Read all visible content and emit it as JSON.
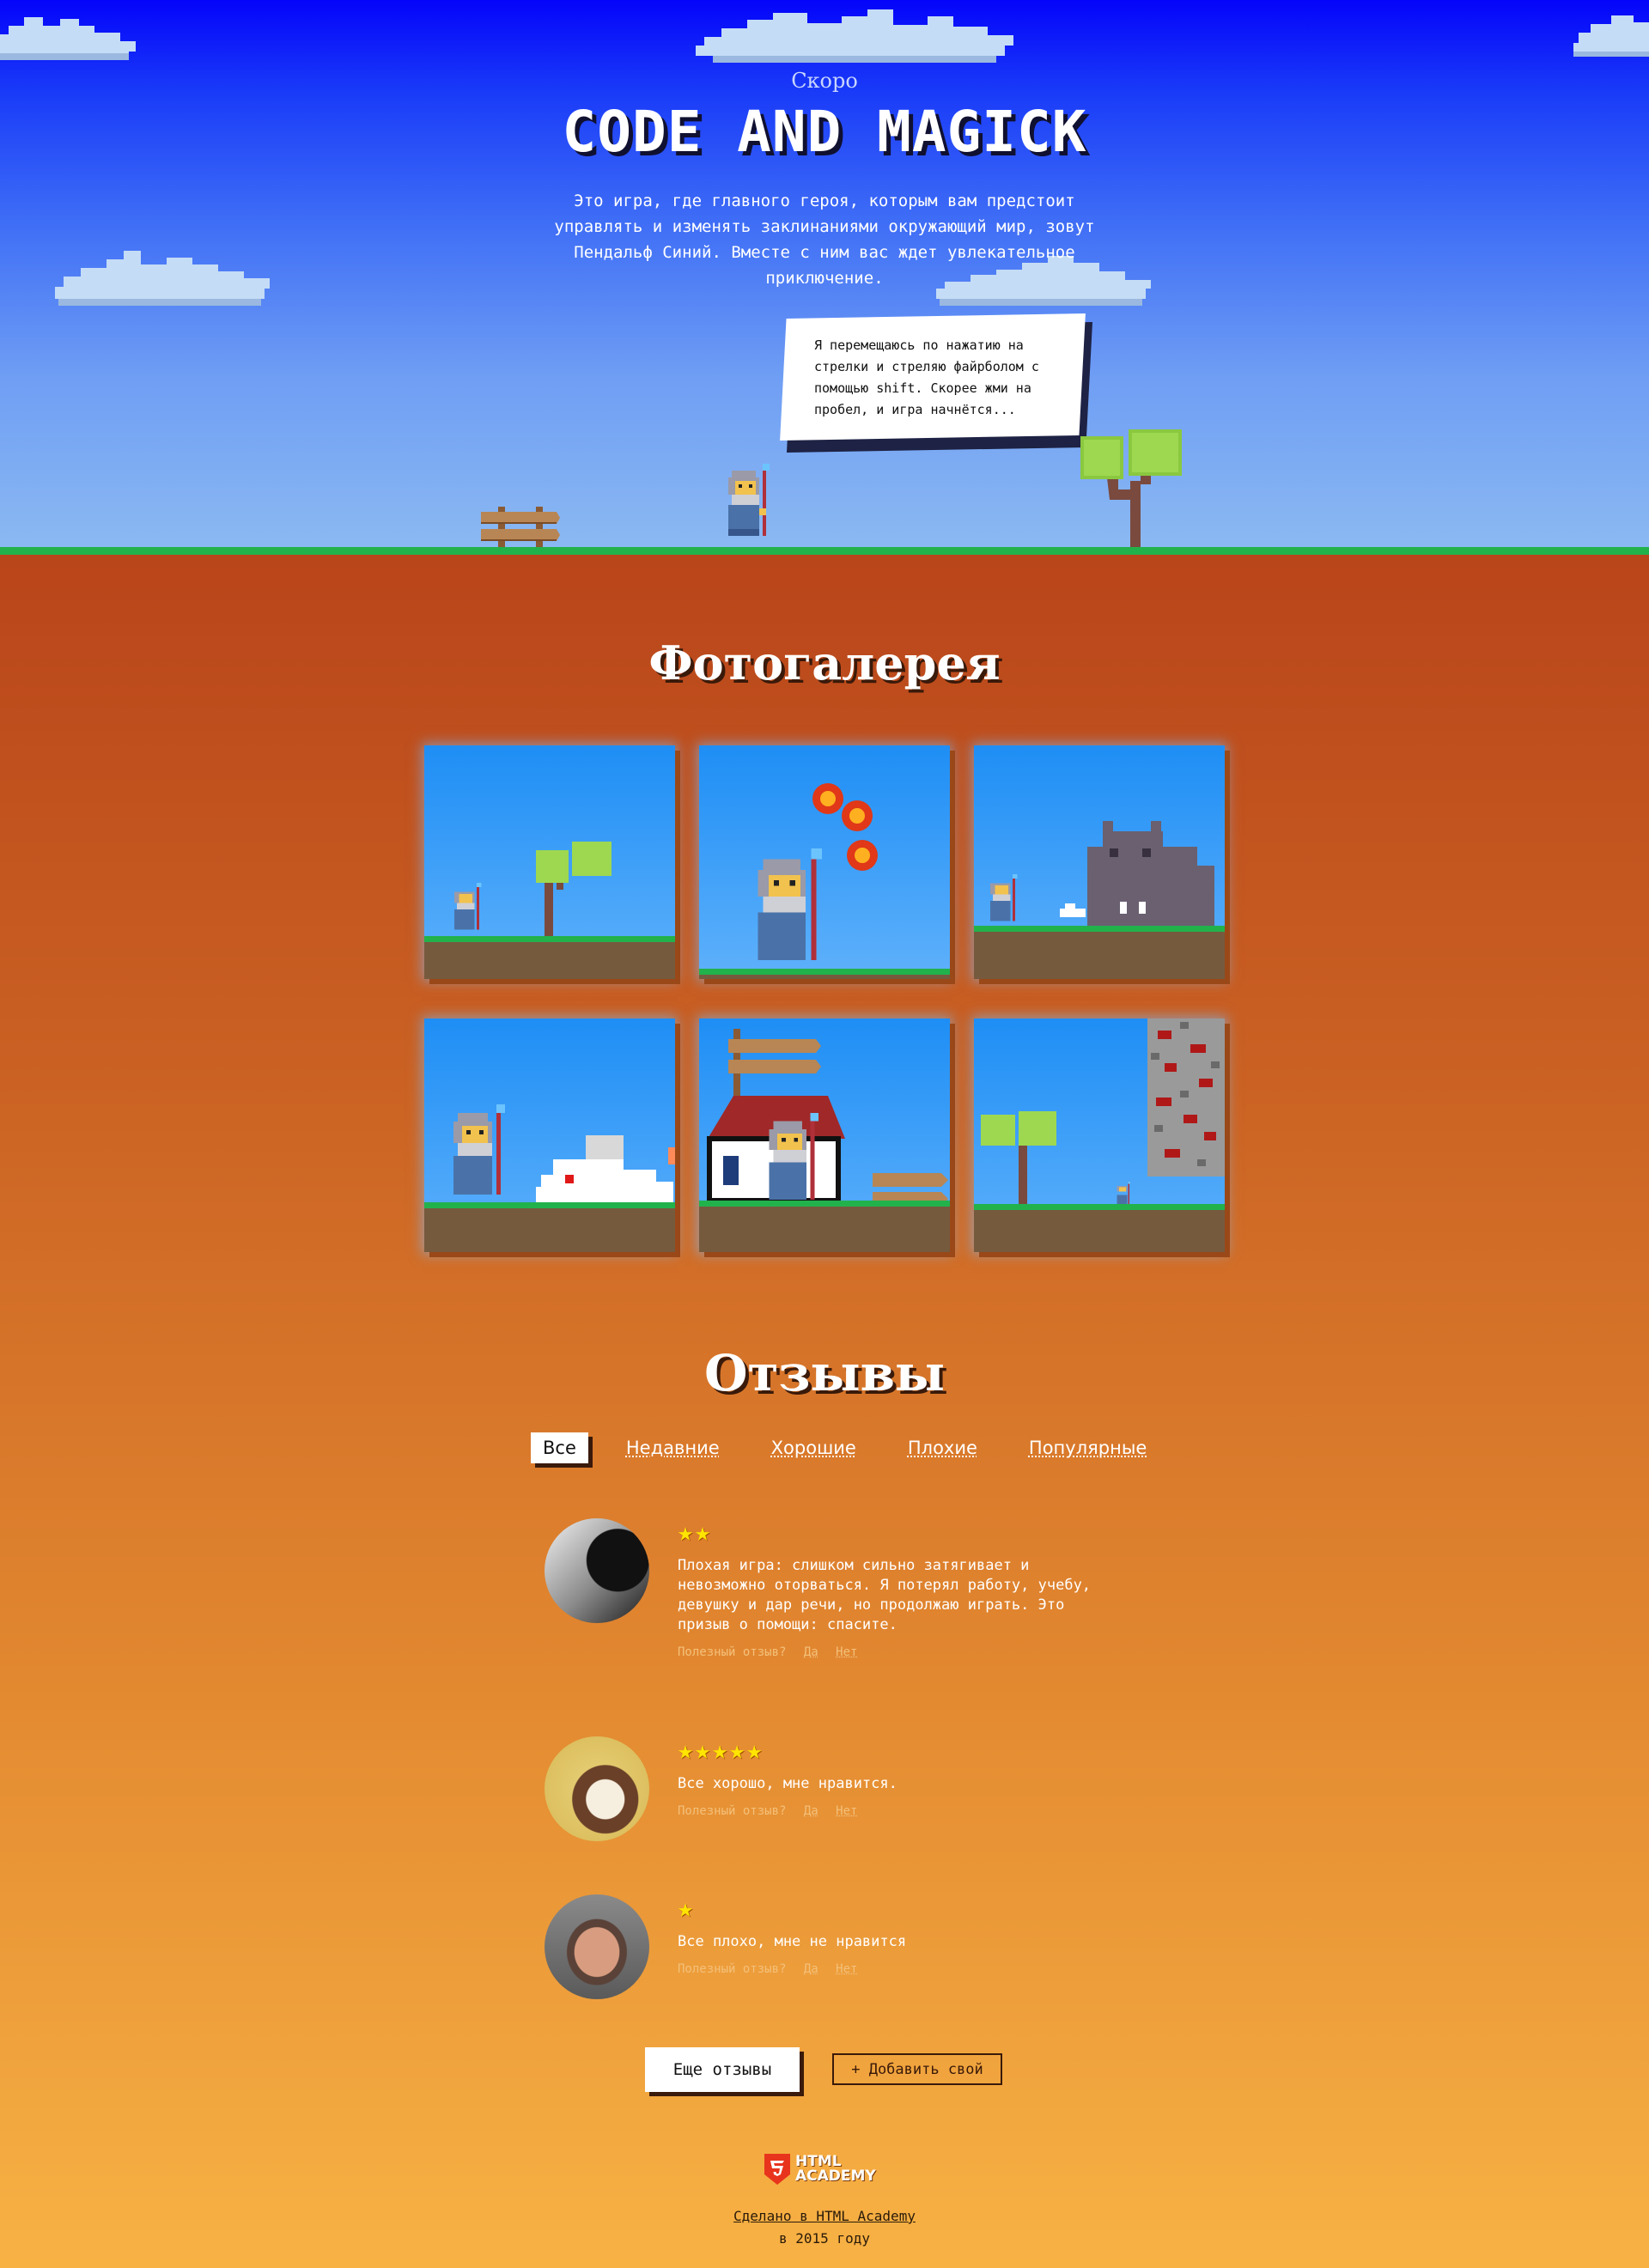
{
  "hero": {
    "coming": "Скоро",
    "title": "Code and Magick",
    "description": "Это игра, где главного героя, которым вам предстоит управлять и изменять заклинаниями окружающий мир, зовут Пендальф Синий. Вместе с ним вас ждет увлекательное приключение.",
    "speech": "Я перемещаюсь по нажатию на стрелки и стреляю файрболом с помощью shift. Скорее жми на пробел, и игра начнётся..."
  },
  "gallery": {
    "title": "Фотогалерея",
    "photos": [
      "wizard-and-tree",
      "wizard-fireballs",
      "wizard-and-hippo",
      "wizard-and-cloud",
      "wizard-and-house",
      "wizard-and-wall"
    ]
  },
  "reviews": {
    "title": "Отзывы",
    "filters": [
      "Все",
      "Недавние",
      "Хорошие",
      "Плохие",
      "Популярные"
    ],
    "active_filter": "Все",
    "items": [
      {
        "stars": "★★",
        "rating": 2,
        "text": "Плохая игра: слишком сильно затягивает и невозможно оторваться. Я потерял работу, учебу, девушку и дар речи, но продолжаю играть. Это призыв о помощи: спасите.",
        "quiz": "Полезный отзыв?",
        "yes": "Да",
        "no": "Нет"
      },
      {
        "stars": "★★★★★",
        "rating": 5,
        "text": "Все хорошо, мне нравится.",
        "quiz": "Полезный отзыв?",
        "yes": "Да",
        "no": "Нет"
      },
      {
        "stars": "★",
        "rating": 1,
        "text": "Все плохо, мне не нравится",
        "quiz": "Полезный отзыв?",
        "yes": "Да",
        "no": "Нет"
      }
    ],
    "more_button": "Еще отзывы",
    "add_button": "+ Добавить свой"
  },
  "footer": {
    "logo_line1": "HTML",
    "logo_line2": "ACADEMY",
    "made_in": "Сделано в HTML Academy",
    "year": "в 2015 году"
  },
  "colors": {
    "sky_top": "#0404fa",
    "sky_bottom": "#8cbaf2",
    "grass": "#22b24c",
    "page_top": "#a4320c",
    "page_bottom": "#f8b244",
    "star": "#ffe500"
  }
}
